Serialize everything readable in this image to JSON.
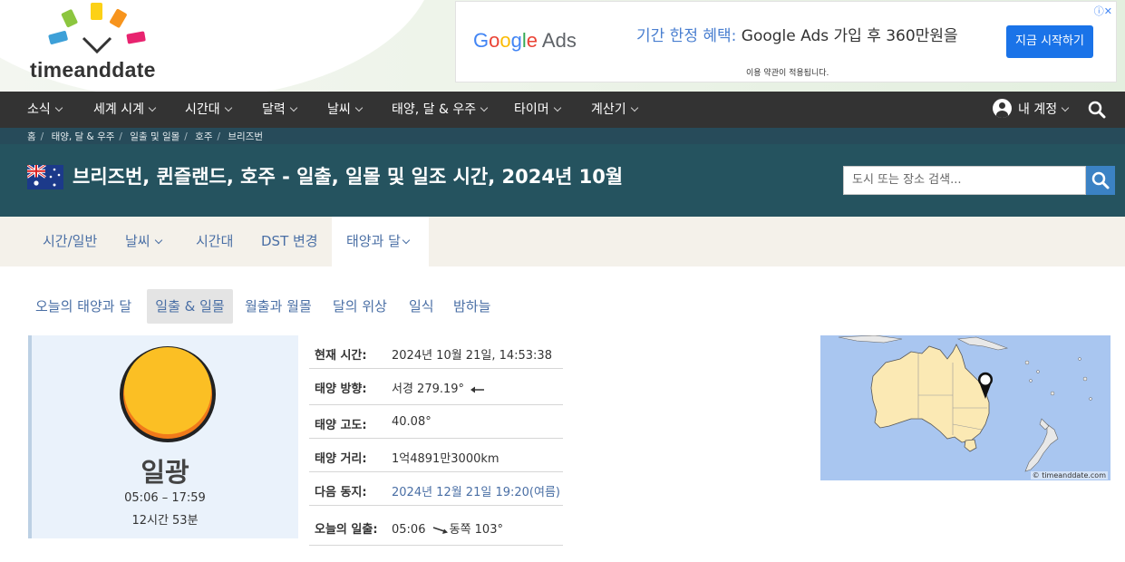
{
  "header": {
    "logo_text": "timeanddate"
  },
  "ad": {
    "brand": "Google Ads",
    "headline_prefix": "기간 한정 혜택:",
    "headline_rest": " Google Ads 가입 후 360만원을",
    "subtext": "이용 약관이 적용됩니다.",
    "cta": "지금 시작하기"
  },
  "nav": {
    "items": [
      "소식",
      "세계 시계",
      "시간대",
      "달력",
      "날씨",
      "태양, 달 & 우주",
      "타이머",
      "계산기"
    ],
    "account_label": "내 계정"
  },
  "breadcrumb": [
    "홈",
    "태양, 달 & 우주",
    "일출 및 일몰",
    "호주",
    "브리즈번"
  ],
  "page": {
    "title": "브리즈번, 퀸즐랜드, 호주 - 일출, 일몰 및 일조 시간, 2024년 10월",
    "search_placeholder": "도시 또는 장소 검색..."
  },
  "tabs": [
    "시간/일반",
    "날씨",
    "시간대",
    "DST 변경",
    "태양과 달"
  ],
  "subtabs": [
    "오늘의 태양과 달",
    "일출 & 일몰",
    "월출과 월몰",
    "달의 위상",
    "일식",
    "밤하늘"
  ],
  "daylight": {
    "label": "일광",
    "range": "05:06 – 17:59",
    "length": "12시간 53분"
  },
  "info": [
    {
      "key": "현재 시간:",
      "value": "2024년 10월 21일, 14:53:38"
    },
    {
      "key": "태양 방향:",
      "value": "서경 279.19°"
    },
    {
      "key": "태양 고도:",
      "value": "40.08°"
    },
    {
      "key": "태양 거리:",
      "value": "1억4891만3000km"
    },
    {
      "key": "다음 동지:",
      "value": "2024년 12월 21일 19:20(여름)"
    },
    {
      "key": "오늘의 일출:",
      "value_time": "05:06",
      "value_dir": "동쪽 103°"
    }
  ],
  "map": {
    "credit": "© timeanddate.com"
  },
  "colors": {
    "nav_bg": "#333333",
    "band_bg": "#25535f",
    "link": "#4a6fa5",
    "sun": "#f9b81b"
  }
}
